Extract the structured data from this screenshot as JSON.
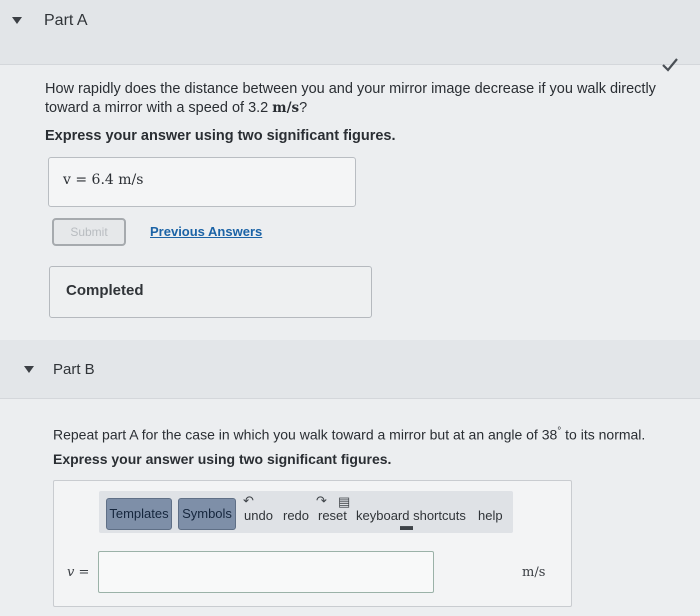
{
  "partA": {
    "label": "Part A",
    "question_line1": "How rapidly does the distance between you and your mirror image decrease if you walk directly",
    "question_line2_pre": "toward a mirror with a speed of 3.2 ",
    "question_unit": "m/s",
    "question_line2_post": "?",
    "instruction": "Express your answer using two significant figures.",
    "answer": "v = 6.4  m/s",
    "submit_label": "Submit",
    "previous_answers_label": "Previous Answers",
    "status": "Completed"
  },
  "partB": {
    "label": "Part B",
    "question_pre": "Repeat part A for the case in which you walk toward a mirror but at an angle of 38",
    "question_deg": "°",
    "question_post": " to its normal.",
    "instruction": "Express your answer using two significant figures.",
    "toolbar": {
      "templates": "Templates",
      "symbols": "Symbols",
      "undo": "undo",
      "redo": "redo",
      "reset": "reset",
      "keyboard_shortcuts": "keyboard shortcuts",
      "help": "help"
    },
    "variable": "v =",
    "input_value": "",
    "unit": "m/s"
  },
  "colors": {
    "link": "#1b63a6",
    "check": "#4a4f55",
    "button": "#7e8fa8"
  }
}
